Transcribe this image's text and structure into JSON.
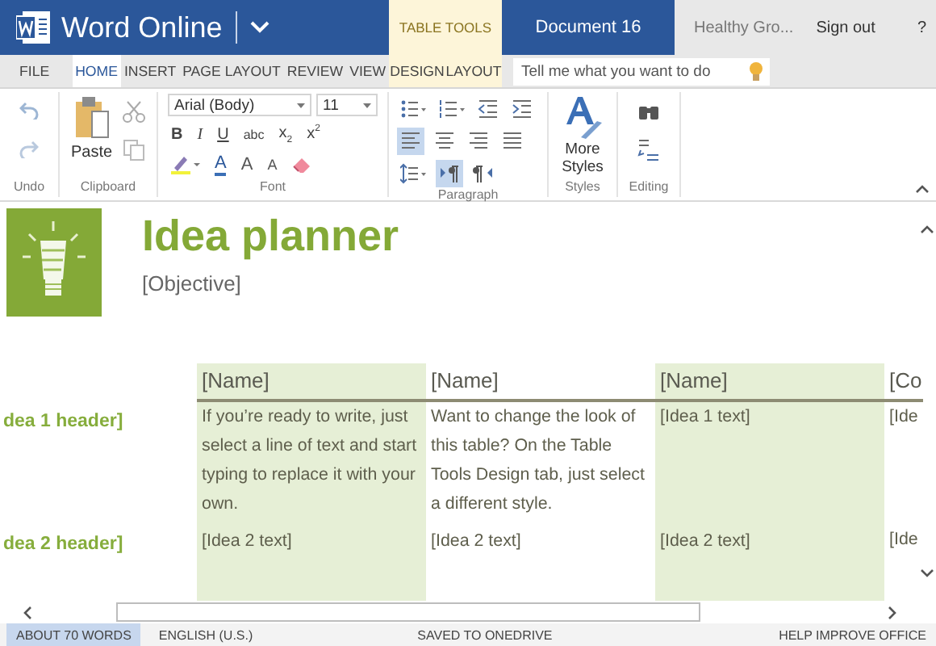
{
  "title_bar": {
    "app_name": "Word Online",
    "contextual_tab": "TABLE TOOLS",
    "document_name": "Document 16",
    "user": "Healthy Gro...",
    "sign_out": "Sign out",
    "help": "?"
  },
  "ribbon_tabs": [
    {
      "label": "FILE",
      "selected": false,
      "contextual": false
    },
    {
      "label": "HOME",
      "selected": true,
      "contextual": false
    },
    {
      "label": "INSERT",
      "selected": false,
      "contextual": false
    },
    {
      "label": "PAGE LAYOUT",
      "selected": false,
      "contextual": false
    },
    {
      "label": "REVIEW",
      "selected": false,
      "contextual": false
    },
    {
      "label": "VIEW",
      "selected": false,
      "contextual": false
    },
    {
      "label": "DESIGN",
      "selected": false,
      "contextual": true
    },
    {
      "label": "LAYOUT",
      "selected": false,
      "contextual": true
    }
  ],
  "tell_me": {
    "placeholder": "Tell me what you want to do"
  },
  "ribbon": {
    "undo": {
      "label": "Undo"
    },
    "clipboard": {
      "label": "Clipboard",
      "paste": "Paste"
    },
    "font": {
      "label": "Font",
      "font_name": "Arial (Body)",
      "font_size": "11",
      "format_buttons": [
        {
          "label": "B",
          "kind": "bold"
        },
        {
          "label": "I",
          "kind": "italic"
        },
        {
          "label": "U",
          "kind": "underline"
        },
        {
          "label": "abc",
          "kind": "strike"
        },
        {
          "label": "x$_{2}$",
          "kind": "sub"
        },
        {
          "label": "x$^{2}$",
          "kind": "sup"
        }
      ],
      "color_buttons": [
        {
          "label": "A",
          "kind": "font-color"
        },
        {
          "label": "A",
          "kind": "grow"
        },
        {
          "label": "A",
          "kind": "shrink"
        }
      ]
    },
    "paragraph": {
      "label": "Paragraph",
      "tools": [
        {
          "kind": "bullets",
          "selected": false
        },
        {
          "kind": "numbering",
          "selected": false
        },
        {
          "kind": "outdent",
          "selected": false
        },
        {
          "kind": "indent",
          "selected": false
        },
        {
          "kind": "align-left",
          "selected": true
        },
        {
          "kind": "align-center",
          "selected": false
        },
        {
          "kind": "align-right",
          "selected": false
        },
        {
          "kind": "justify",
          "selected": false
        },
        {
          "kind": "line-spacing",
          "selected": false
        },
        {
          "kind": "ltr",
          "selected": true
        },
        {
          "kind": "rtl",
          "selected": false
        }
      ]
    },
    "styles": {
      "label": "Styles",
      "button": "More Styles"
    },
    "editing": {
      "label": "Editing"
    }
  },
  "document": {
    "title": "Idea planner",
    "objective": "[Objective]",
    "table": {
      "columns": [
        "[Name]",
        "[Name]",
        "[Name]",
        "[Co"
      ],
      "rows": [
        {
          "header": "dea 1 header]",
          "cells": [
            "If you’re ready to write, just select a line of text and start typing to replace it with your own.",
            "Want to change the look of this table? On the Table Tools Design tab, just select a different style.",
            "[Idea 1 text]",
            "[Ide"
          ]
        },
        {
          "header": "dea 2 header]",
          "cells": [
            "[Idea 2 text]",
            "[Idea 2 text]",
            "[Idea 2 text]",
            "[Ide"
          ]
        }
      ]
    }
  },
  "status_bar": [
    {
      "label": "ABOUT 70 WORDS",
      "selected": true
    },
    {
      "label": "ENGLISH (U.S.)",
      "selected": false
    },
    {
      "label": "SAVED TO ONEDRIVE",
      "selected": false
    },
    {
      "label": "HELP IMPROVE OFFICE",
      "selected": false
    }
  ]
}
